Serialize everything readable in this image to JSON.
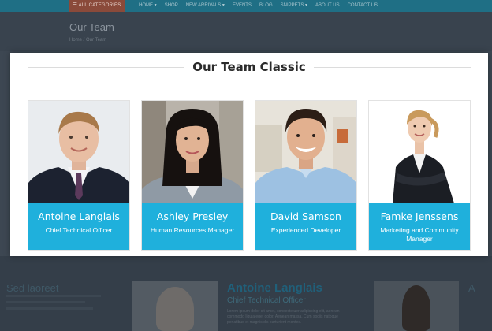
{
  "background_page": {
    "category_button": "☰ ALL CATEGORIES",
    "menu_items": [
      "HOME ▾",
      "SHOP",
      "NEW ARRIVALS ▾",
      "EVENTS",
      "BLOG",
      "SNIPPETS ▾",
      "ABOUT US",
      "CONTACT US"
    ],
    "page_title": "Our Team",
    "breadcrumb": "Home  /  Our Team",
    "featured_name": "Antoine Langlais",
    "featured_role": "Chief Technical Officer",
    "featured_text": "Lorem ipsum dolor sit amet, consectetuer adipiscing elit, aenean commodo ligula eget dolor. Aenean massa. Cum sociis natoque penatibus et magnis dis parturient montes.",
    "side_left": "Sed laoreet",
    "side_right": "A"
  },
  "modal": {
    "title": "Our Team Classic"
  },
  "team": [
    {
      "name": "Antoine Langlais",
      "role": "Chief Technical Officer"
    },
    {
      "name": "Ashley Presley",
      "role": "Human Resources Manager"
    },
    {
      "name": "David Samson",
      "role": "Experienced Developer"
    },
    {
      "name": "Famke Jenssens",
      "role": "Marketing and Community Manager"
    }
  ],
  "colors": {
    "accent": "#1fb0dc",
    "overlay": "#3d4752",
    "nav_bar": "#1f6f85"
  }
}
